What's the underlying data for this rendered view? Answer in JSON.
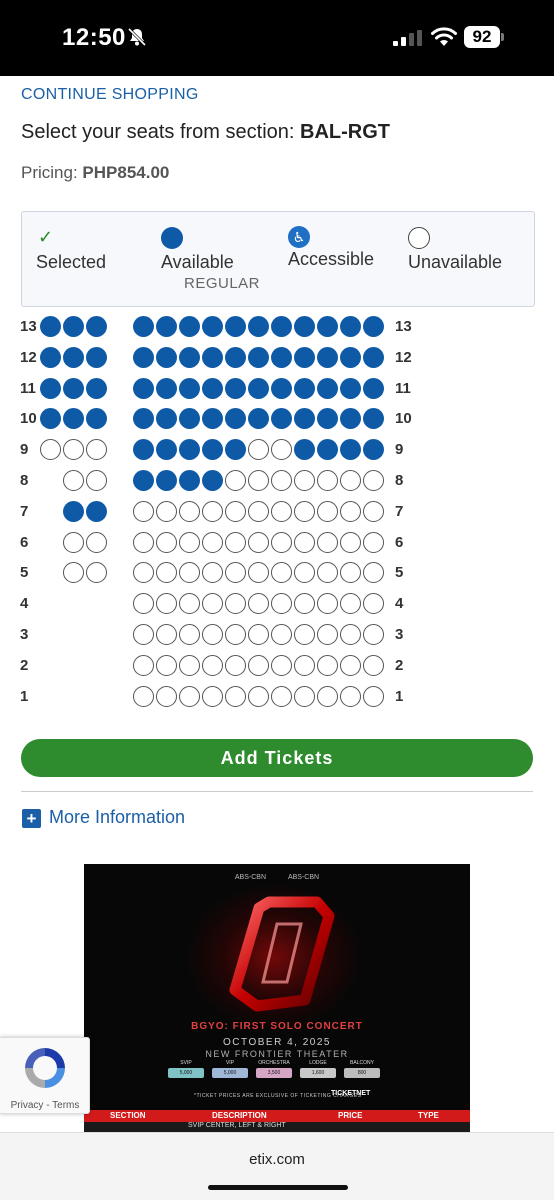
{
  "status_bar": {
    "time": "12:50",
    "battery": "92"
  },
  "nav": {
    "continue_label": "CONTINUE SHOPPING"
  },
  "page": {
    "title_prefix": "Select your seats from section: ",
    "section": "BAL-RGT",
    "pricing_label": "Pricing: ",
    "price": "PHP854.00"
  },
  "legend": {
    "selected": "Selected",
    "available": "Available",
    "available_sub": "REGULAR",
    "accessible": "Accessible",
    "unavailable": "Unavailable"
  },
  "seat_rows": [
    {
      "label": "13",
      "left": "AAA",
      "right": "AAAAAAAAAAA"
    },
    {
      "label": "12",
      "left": "AAA",
      "right": "AAAAAAAAAAA"
    },
    {
      "label": "11",
      "left": "AAA",
      "right": "AAAAAAAAAAA"
    },
    {
      "label": "10",
      "left": "AAA",
      "right": "AAAAAAAAAAA"
    },
    {
      "label": "9",
      "left": "UUU",
      "right": "AAAAAUUAAAA"
    },
    {
      "label": "8",
      "left": "-UU",
      "right": "AAAAUUUUUUU"
    },
    {
      "label": "7",
      "left": "-AA",
      "right": "UUUUUUUUUUU"
    },
    {
      "label": "6",
      "left": "-UU",
      "right": "UUUUUUUUUUU"
    },
    {
      "label": "5",
      "left": "-UU",
      "right": "UUUUUUUUUUU"
    },
    {
      "label": "4",
      "left": "---",
      "right": "UUUUUUUUUUU"
    },
    {
      "label": "3",
      "left": "---",
      "right": "UUUUUUUUUUU"
    },
    {
      "label": "2",
      "left": "---",
      "right": "UUUUUUUUUUU"
    },
    {
      "label": "1",
      "left": "---",
      "right": "UUUUUUUUUUU"
    }
  ],
  "actions": {
    "add_tickets": "Add Tickets",
    "more_info": "More Information"
  },
  "poster": {
    "logo_1": "ABS-CBN",
    "logo_2": "ABS-CBN",
    "title": "BGYO: FIRST SOLO CONCERT",
    "date": "OCTOBER 4, 2025",
    "venue": "NEW FRONTIER THEATER",
    "tiers": [
      {
        "name": "SVIP",
        "price": "5,000",
        "color": "#7fc3c7"
      },
      {
        "name": "VIP",
        "price": "5,000",
        "color": "#9fb8d8"
      },
      {
        "name": "ORCHESTRA",
        "price": "3,500",
        "color": "#d6a6c6"
      },
      {
        "name": "LODGE",
        "price": "1,600",
        "color": "#c8c8c8"
      },
      {
        "name": "BALCONY",
        "price": "800",
        "color": "#bdbdbd"
      }
    ],
    "note": "*TICKET PRICES ARE EXCLUSIVE OF TICKETING CHARGES",
    "ticketnet": "TICKETNET",
    "table_headers": [
      "SECTION",
      "DESCRIPTION",
      "PRICE",
      "TYPE"
    ],
    "table_row_desc": "SVIP CENTER, LEFT & RIGHT"
  },
  "recaptcha": {
    "text": "Privacy - Terms"
  },
  "browser": {
    "url": "etix.com"
  }
}
